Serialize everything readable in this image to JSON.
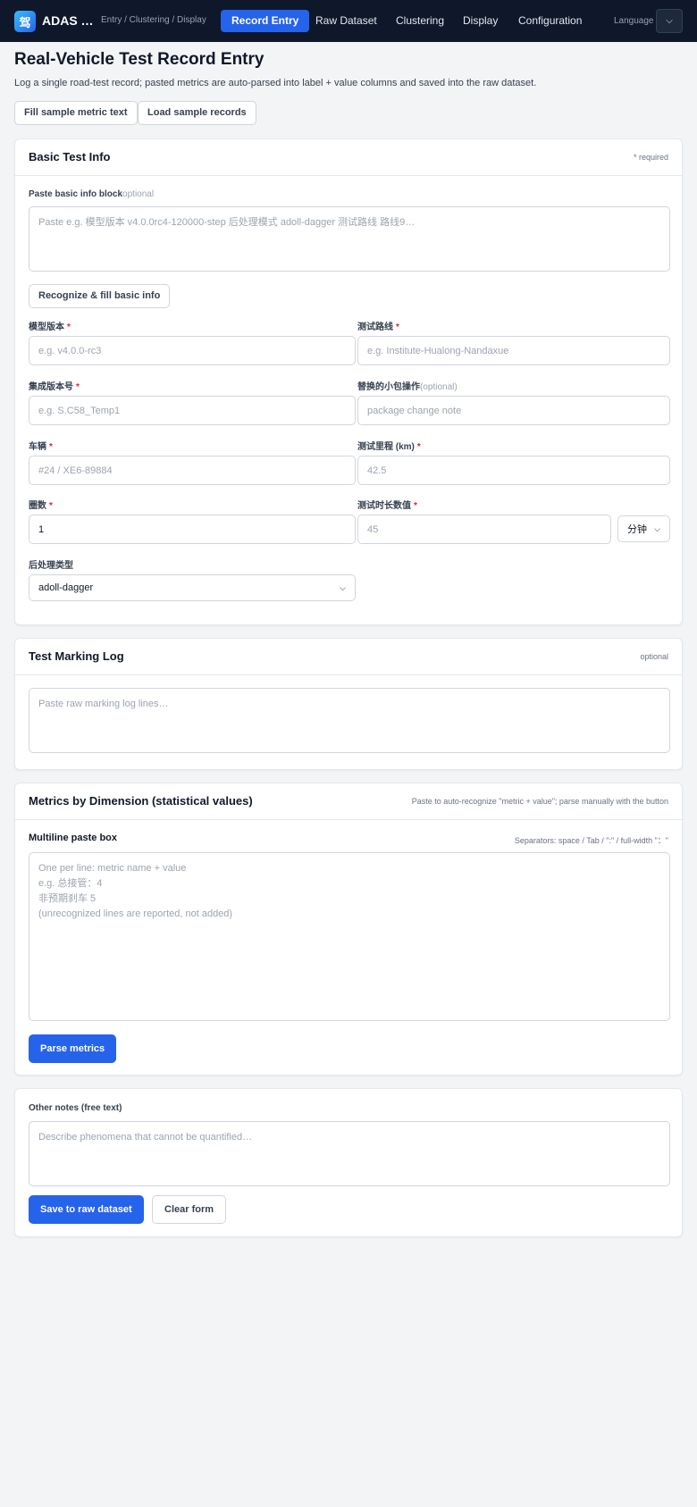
{
  "app": {
    "logo_glyph": "驾",
    "name": "ADAS …",
    "breadcrumb": "Entry / Clustering / Display",
    "language_label": "Language",
    "accent_color": "#2563eb",
    "nav_bg_color": "#0f172a"
  },
  "nav": {
    "tabs": [
      {
        "label": "Record Entry",
        "active": true
      },
      {
        "label": "Raw Dataset",
        "active": false
      },
      {
        "label": "Clustering",
        "active": false
      },
      {
        "label": "Display",
        "active": false
      },
      {
        "label": "Configuration",
        "active": false
      }
    ]
  },
  "page": {
    "title": "Real-Vehicle Test Record Entry",
    "description": "Log a single road-test record; pasted metrics are auto-parsed into label + value columns and saved into the raw dataset.",
    "fill_sample_label": "Fill sample metric text",
    "load_sample_label": "Load sample records"
  },
  "basic": {
    "title": "Basic Test Info",
    "required_hint": "* required",
    "paste_label": "Paste basic info block",
    "paste_optional": "optional",
    "paste_placeholder": "Paste e.g. 模型版本 v4.0.0rc4-120000-step 后处理模式 adoll-dagger 测试路线 路线9…",
    "recognize_label": "Recognize & fill basic info",
    "model_version_label": "模型版本",
    "model_version_placeholder": "e.g. v4.0.0-rc3",
    "route_label": "测试路线",
    "route_placeholder": "e.g. Institute-Hualong-Nandaxue",
    "integration_label": "集成版本号",
    "integration_placeholder": "e.g. S.C58_Temp1",
    "package_label": "替换的小包操作",
    "package_optional": "(optional)",
    "package_placeholder": "package change note",
    "vehicle_label": "车辆",
    "vehicle_placeholder": "#24 / XE6-89884",
    "mileage_label": "测试里程 (km)",
    "mileage_placeholder": "42.5",
    "laps_label": "圈数",
    "laps_value": "1",
    "duration_label": "测试时长数值",
    "duration_placeholder": "45",
    "duration_unit": "分钟",
    "postproc_label": "后处理类型",
    "postproc_value": "adoll-dagger",
    "required_mark": "*"
  },
  "marking": {
    "title": "Test Marking Log",
    "optional_hint": "optional",
    "placeholder": "Paste raw marking log lines…"
  },
  "metrics": {
    "title": "Metrics by Dimension (statistical values)",
    "hint": "Paste to auto-recognize \"metric + value\"; parse manually with the button",
    "paste_label": "Multiline paste box",
    "separators_hint": "Separators: space / Tab / \":\" / full-width \"：\"",
    "placeholder": "One per line: metric name + value\ne.g. 总接管：4\n非预期刹车 5\n(unrecognized lines are reported, not added)",
    "parse_label": "Parse metrics"
  },
  "notes": {
    "label": "Other notes (free text)",
    "placeholder": "Describe phenomena that cannot be quantified…",
    "save_label": "Save to raw dataset",
    "clear_label": "Clear form"
  }
}
